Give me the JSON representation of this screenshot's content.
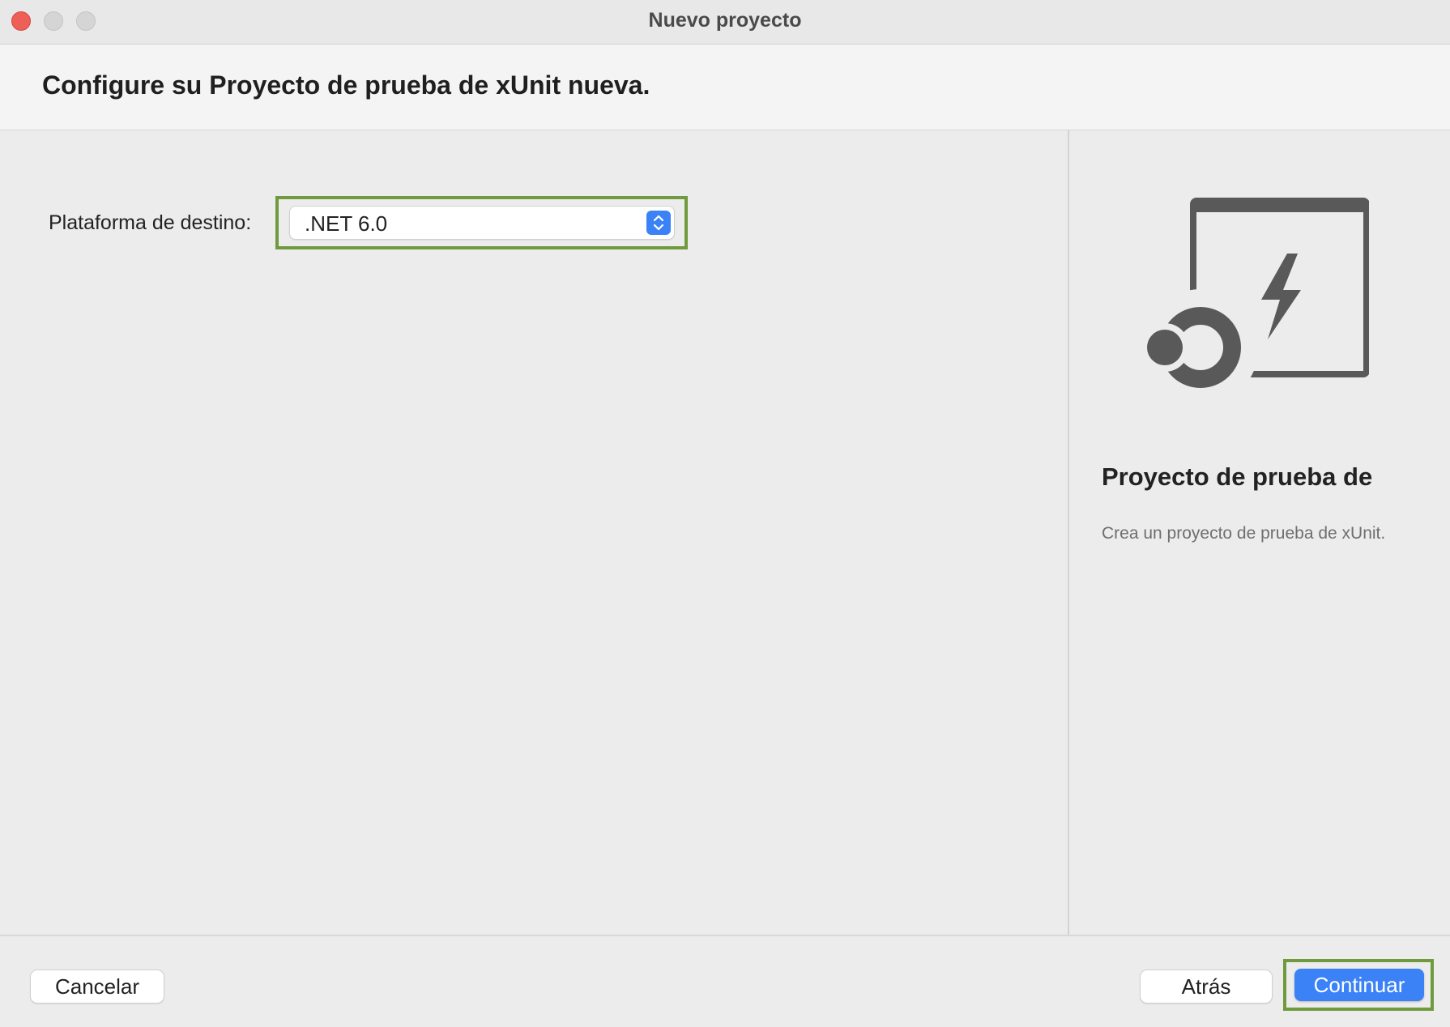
{
  "window": {
    "title": "Nuevo proyecto"
  },
  "header": {
    "title": "Configure su Proyecto de prueba de xUnit nueva."
  },
  "form": {
    "target_platform_label": "Plataforma de destino:",
    "target_platform_value": ".NET 6.0"
  },
  "template": {
    "icon": "xunit-test-project-icon",
    "name": "Proyecto de prueba de",
    "description": "Crea un proyecto de prueba de xUnit."
  },
  "footer": {
    "cancel_label": "Cancelar",
    "back_label": "Atrás",
    "continue_label": "Continuar"
  },
  "colors": {
    "accent": "#3b82f6",
    "highlight": "#6f9a3e",
    "close_button": "#ee5f58",
    "icon_gray": "#595959"
  }
}
